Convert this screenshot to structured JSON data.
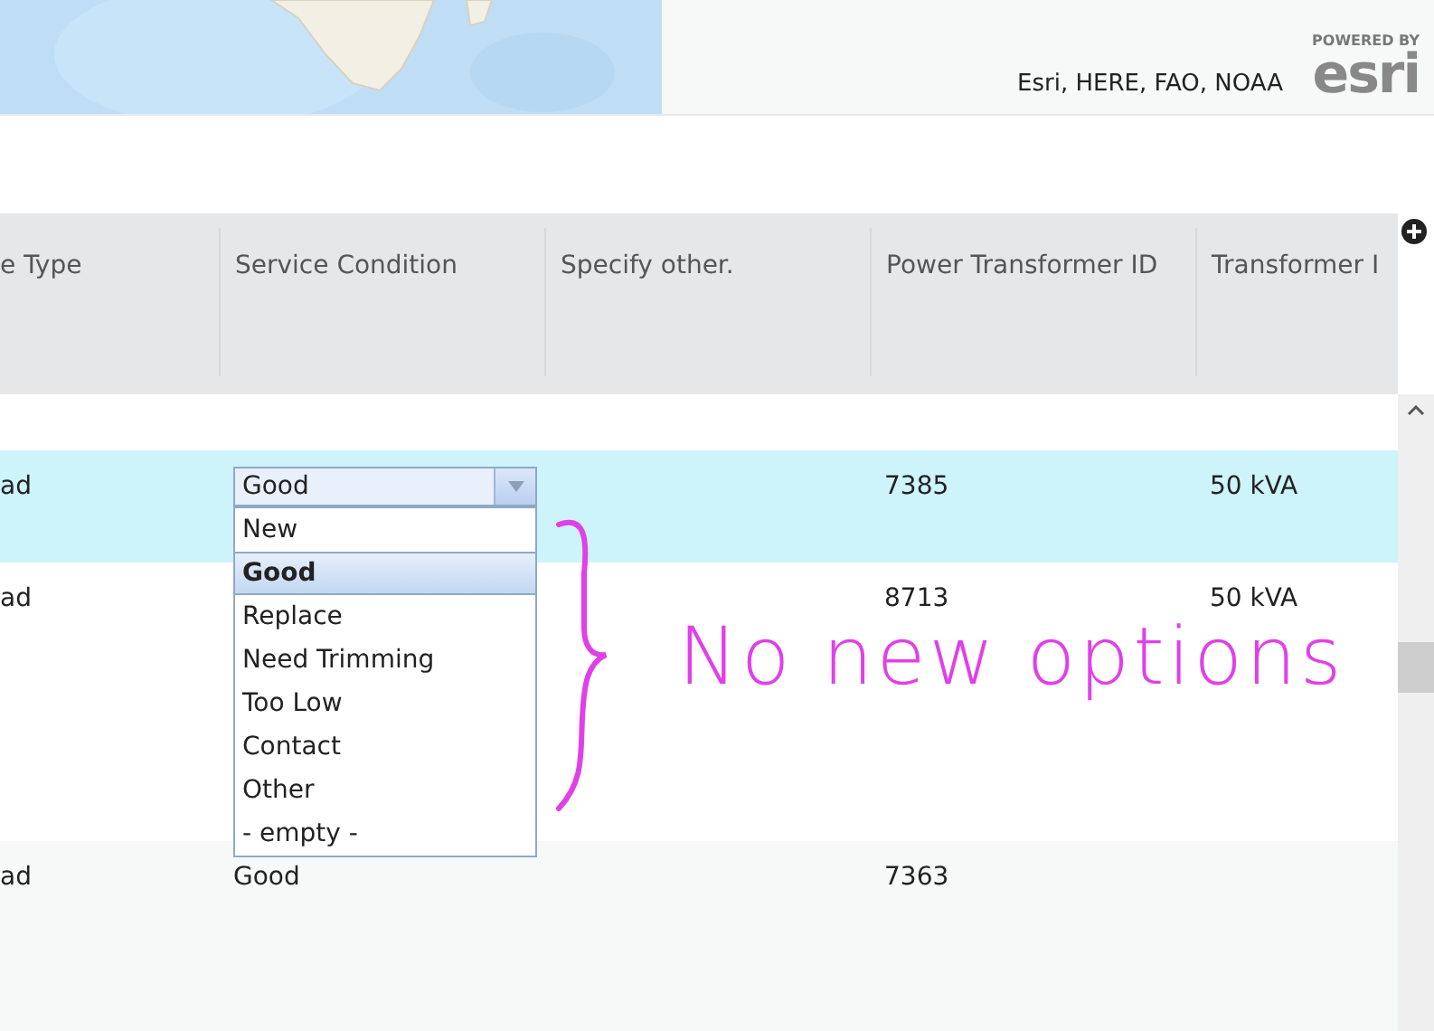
{
  "map": {
    "attribution": "Esri, HERE, FAO, NOAA",
    "logo_caption": "POWERED BY",
    "logo": "esri"
  },
  "table": {
    "columns": [
      "e Type",
      "Service Condition",
      "Specify other.",
      "Power Transformer ID",
      "Transformer I"
    ],
    "rows": [
      {
        "selected": true,
        "cells": [
          "ad",
          null,
          null,
          "7385",
          "50 kVA"
        ],
        "editor": {
          "value": "Good",
          "expanded": true,
          "options": [
            {
              "label": "New",
              "selected": false
            },
            {
              "label": "Good",
              "selected": true
            },
            {
              "label": "Replace",
              "selected": false
            },
            {
              "label": "Need Trimming",
              "selected": false
            },
            {
              "label": "Too Low",
              "selected": false
            },
            {
              "label": "Contact",
              "selected": false
            },
            {
              "label": "Other",
              "selected": false
            },
            {
              "label": "- empty -",
              "selected": false
            }
          ]
        }
      },
      {
        "selected": false,
        "cells": [
          "ad",
          null,
          null,
          "8713",
          "50 kVA"
        ]
      },
      {
        "selected": false,
        "cells": [
          "ad",
          "Good",
          null,
          "7363",
          null
        ]
      }
    ]
  },
  "annotation": {
    "text": "No new options"
  }
}
